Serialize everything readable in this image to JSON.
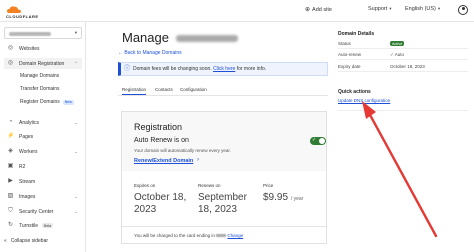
{
  "topbar": {
    "logo_text": "CLOUDFLARE",
    "add_site": "Add site",
    "support": "Support",
    "language": "English (US)"
  },
  "sidebar": {
    "items": [
      {
        "label": "Websites",
        "icon": "globe-icon"
      },
      {
        "label": "Domain Registration",
        "icon": "globe-icon"
      },
      {
        "label": "Analytics",
        "icon": "chart-icon"
      },
      {
        "label": "Pages",
        "icon": "pages-icon"
      },
      {
        "label": "Workers",
        "icon": "workers-icon"
      },
      {
        "label": "R2",
        "icon": "bucket-icon"
      },
      {
        "label": "Stream",
        "icon": "stream-icon"
      },
      {
        "label": "Images",
        "icon": "image-icon"
      },
      {
        "label": "Security Center",
        "icon": "shield-icon"
      },
      {
        "label": "Turnstile",
        "icon": "turnstile-icon"
      }
    ],
    "sub_items": [
      {
        "label": "Manage Domains"
      },
      {
        "label": "Transfer Domains"
      },
      {
        "label": "Register Domains"
      }
    ],
    "badges": {
      "new": "New",
      "beta": "Beta"
    },
    "collapse_label": "Collapse sidebar"
  },
  "main": {
    "title": "Manage",
    "back_link": "← Back to Manage Domains",
    "banner_text": "Domain fees will be changing soon.",
    "banner_link": "Click here",
    "banner_suffix": "for more info.",
    "tabs": [
      "Registration",
      "Contacts",
      "Configuration"
    ],
    "card": {
      "title": "Registration",
      "auto_renew_title": "Auto Renew is on",
      "auto_renew_desc": "Your domain will automatically renew every year.",
      "renew_link": "Renew/Extend Domain",
      "expires_label": "Expires on",
      "expires_value": "October 18, 2023",
      "renews_label": "Renews on",
      "renews_value": "September 18, 2023",
      "price_label": "Price",
      "price_value": "$9.95",
      "price_unit": "/ year",
      "footer_text": "You will be charged to the card ending in",
      "footer_link": "Change"
    }
  },
  "details": {
    "title": "Domain Details",
    "rows": [
      {
        "key": "Status",
        "value": "Active"
      },
      {
        "key": "Auto-renew",
        "value": "Auto"
      },
      {
        "key": "Expiry date",
        "value": "October 18, 2023"
      }
    ],
    "quick_actions_title": "Quick actions",
    "quick_action_link": "Update DNS configuration"
  },
  "colors": {
    "accent": "#1d4fd7",
    "active_green": "#2f7d32",
    "annotation_red": "#e53935"
  }
}
